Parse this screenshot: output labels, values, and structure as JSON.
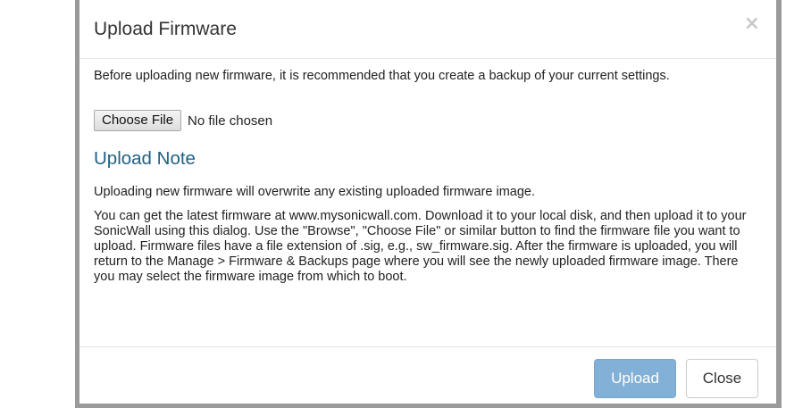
{
  "dialog": {
    "title": "Upload Firmware",
    "close_glyph": "×",
    "intro": "Before uploading new firmware, it is recommended that you create a backup of your current settings.",
    "file_input": {
      "button_label": "Choose File",
      "status": "No file chosen"
    },
    "note_heading": "Upload Note",
    "note_paragraph_1": "Uploading new firmware will overwrite any existing uploaded firmware image.",
    "note_paragraph_2": "You can get the latest firmware at www.mysonicwall.com. Download it to your local disk, and then upload it to your SonicWall using this dialog. Use the \"Browse\", \"Choose File\" or similar button to find the firmware file you want to upload. Firmware files have a file extension of .sig, e.g., sw_firmware.sig. After the firmware is uploaded, you will return to the Manage > Firmware & Backups page where you will see the newly uploaded firmware image. There you may select the firmware image from which to boot.",
    "footer": {
      "upload_label": "Upload",
      "close_label": "Close"
    }
  },
  "colors": {
    "heading_accent": "#1e6283",
    "primary_button": "#83b0d6",
    "backdrop": "#9a9a9a"
  }
}
